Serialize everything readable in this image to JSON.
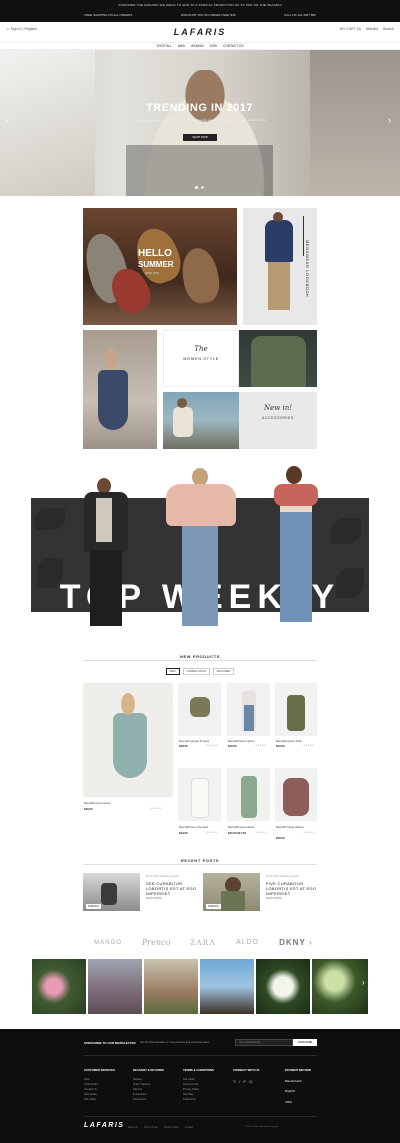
{
  "topbar": {
    "promo": "CONSIDER THE FASHION WE WEAR TO ADD TO A SPECIAL PROMOTION UP TO 50% ON THE SEASON!",
    "left": "FREE SHIPPING ON ALL ORDERS",
    "center": "DISCOUNT 15% ON ORDER OVER $49",
    "right": "CALL US 123 4567 890"
  },
  "header": {
    "logo": "LAFARIS",
    "sign_in": "Sign In",
    "register": "Register",
    "links": [
      "MY CART (0)",
      "Wishlist",
      "Search"
    ]
  },
  "nav": [
    "SHOP ALL",
    "MAN",
    "WOMAN",
    "KIDS",
    "CONTACT US"
  ],
  "hero": {
    "title": "TRENDING IN 2017",
    "subtitle": "This season, we've curated a collection of our favourite pieces for a relaxed and easy summer style",
    "button": "SHOP NOW",
    "prev_icon": "chevron-left-icon",
    "next_icon": "chevron-right-icon"
  },
  "banners": {
    "hello_1": "HELLO",
    "hello_2": "SUMMER",
    "hello_small": "SHOP NOW",
    "lookbook": "MENSWEAR LOOKBOOK",
    "women_the": "The",
    "women_style": "WOMEN STYLE",
    "newin": "New in!",
    "accessories": "ACCESSORIES"
  },
  "top_weekly": "TOP WEEKLY",
  "new_products": {
    "title": "NEW PRODUCTS",
    "tabs": [
      "NEW",
      "COMING SOON",
      "FEATURED"
    ],
    "featured": {
      "name": "Demo01 lorem ipsum",
      "price": "$18.00"
    },
    "items": [
      {
        "name": "Demo02 jumper & boots",
        "price": "$18.00"
      },
      {
        "name": "Demo03 lorem ipsum",
        "price": "$16.00"
      },
      {
        "name": "Demo04 ipsum dolor",
        "price": "$19.00"
      },
      {
        "name": "Demo05 lorem the best",
        "price": "$19.00"
      },
      {
        "name": "Demo06 green dress",
        "price": "$15.00 $17.00"
      },
      {
        "name": "Demo07 fringe pattern",
        "price": "$18.00"
      }
    ]
  },
  "recent_posts": {
    "title": "RECENT POSTS",
    "posts": [
      {
        "date": "18 Apr 2017 Posted by admin",
        "title": "SEE CURABITUR LOBORTIS EST AT EGO IMPERDIET",
        "more": "READ MORE",
        "tag": "FASHION"
      },
      {
        "date": "18 Apr 2017 Posted by admin",
        "title": "FIVE CURABITUR LOBORTIS EST AT EGO IMPERDIET",
        "more": "READ MORE",
        "tag": "FASHION"
      }
    ]
  },
  "brands": [
    "MANGO",
    "Prenco",
    "ZARA",
    "ALDO",
    "DKNY"
  ],
  "footer": {
    "newsletter_label": "SUBSCRIBE TO OUR NEWSLETTER",
    "newsletter_desc": "Get the latest updates on new products and upcoming sales",
    "email_placeholder": "Your email address",
    "subscribe": "SUBSCRIBE",
    "columns": [
      {
        "title": "CUSTOMER SERVICES",
        "items": [
          "Help",
          "Track Order",
          "Contact Us",
          "Size Guide",
          "Gift Cards"
        ]
      },
      {
        "title": "DELIVERY & RETURNS",
        "items": [
          "Delivery",
          "Order Tracking",
          "Returns",
          "E-Vouchers",
          "Promotions"
        ]
      },
      {
        "title": "TERMS & CONDITIONS",
        "items": [
          "Gift Cards",
          "Terms of Use",
          "Privacy Policy",
          "Site Map",
          "Collections"
        ]
      },
      {
        "title": "CONNECT WITH US",
        "items": []
      },
      {
        "title": "PAYMENT METHOD",
        "items": []
      }
    ],
    "payments": [
      "MasterCard",
      "PayPal",
      "VISA"
    ],
    "logo": "LAFARIS",
    "bottom_links": [
      "About Us",
      "Terms of Use",
      "Privacy Policy",
      "Contact"
    ],
    "copyright": "© 2017 Lafaris. All rights reserved."
  }
}
